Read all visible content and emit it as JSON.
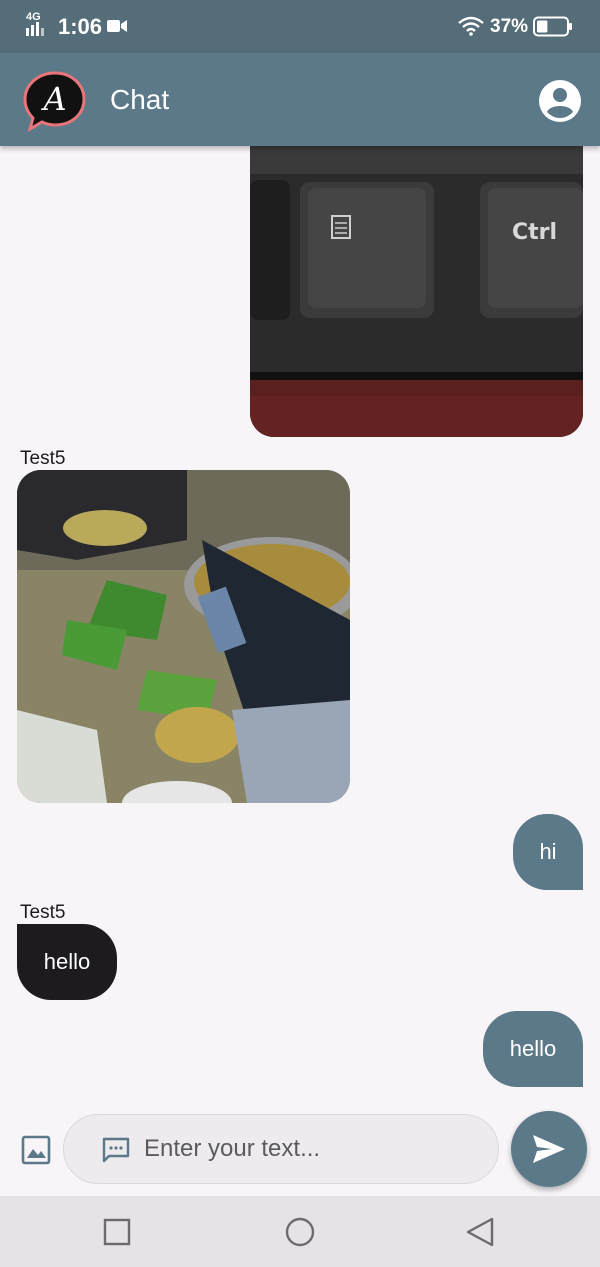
{
  "status_bar": {
    "network": "4G",
    "time": "1:06",
    "battery_percent": "37%",
    "battery_level": 0.37
  },
  "app_bar": {
    "logo_letter": "A",
    "title": "Chat"
  },
  "messages": [
    {
      "type": "image",
      "direction": "outgoing",
      "image_desc": "keyboard-keys-photo",
      "visible_text": "Ctrl"
    },
    {
      "type": "image",
      "direction": "incoming",
      "sender": "Test5",
      "image_desc": "food-serving-photo"
    },
    {
      "type": "text",
      "direction": "outgoing",
      "text": "hi"
    },
    {
      "type": "text",
      "direction": "incoming",
      "sender": "Test5",
      "text": "hello"
    },
    {
      "type": "text",
      "direction": "outgoing",
      "text": "hello"
    }
  ],
  "composer": {
    "placeholder": "Enter your text..."
  },
  "colors": {
    "primary": "#5b7988",
    "status_bar": "#556d79",
    "incoming_bubble": "#1d1b1f",
    "background": "#f8f5f9"
  }
}
